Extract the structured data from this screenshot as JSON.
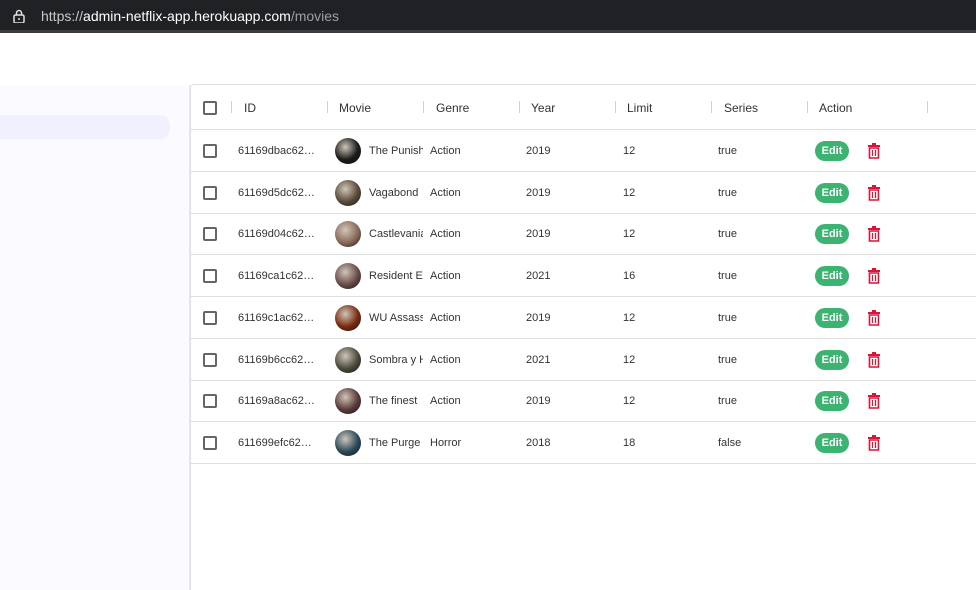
{
  "browser": {
    "url_scheme": "https://",
    "url_host": "admin-netflix-app.herokuapp.com",
    "url_path": "/movies"
  },
  "table": {
    "columns": [
      "ID",
      "Movie",
      "Genre",
      "Year",
      "Limit",
      "Series",
      "Action"
    ],
    "edit_label": "Edit",
    "rows": [
      {
        "id": "61169dbac62…",
        "movie": "The Punisher",
        "genre": "Action",
        "year": "2019",
        "limit": "12",
        "series": "true",
        "avatar_color": "#1a1a1a"
      },
      {
        "id": "61169d5dc62…",
        "movie": "Vagabond",
        "genre": "Action",
        "year": "2019",
        "limit": "12",
        "series": "true",
        "avatar_color": "#5a4a3a"
      },
      {
        "id": "61169d04c62…",
        "movie": "Castlevania",
        "genre": "Action",
        "year": "2019",
        "limit": "12",
        "series": "true",
        "avatar_color": "#8a6a5a"
      },
      {
        "id": "61169ca1c62…",
        "movie": "Resident Evil",
        "genre": "Action",
        "year": "2021",
        "limit": "16",
        "series": "true",
        "avatar_color": "#6a4a4a"
      },
      {
        "id": "61169c1ac62…",
        "movie": "WU Assassins",
        "genre": "Action",
        "year": "2019",
        "limit": "12",
        "series": "true",
        "avatar_color": "#7a2a10"
      },
      {
        "id": "61169b6cc62…",
        "movie": "Sombra y Hueso",
        "genre": "Action",
        "year": "2021",
        "limit": "12",
        "series": "true",
        "avatar_color": "#4a4a3a"
      },
      {
        "id": "61169a8ac62…",
        "movie": "The finest",
        "genre": "Action",
        "year": "2019",
        "limit": "12",
        "series": "true",
        "avatar_color": "#5a3a3a"
      },
      {
        "id": "611699efc62…",
        "movie": "The Purge",
        "genre": "Horror",
        "year": "2018",
        "limit": "18",
        "series": "false",
        "avatar_color": "#2a4a5a"
      }
    ]
  },
  "colors": {
    "edit_button": "#3cb371",
    "delete_icon": "#dc143c"
  }
}
